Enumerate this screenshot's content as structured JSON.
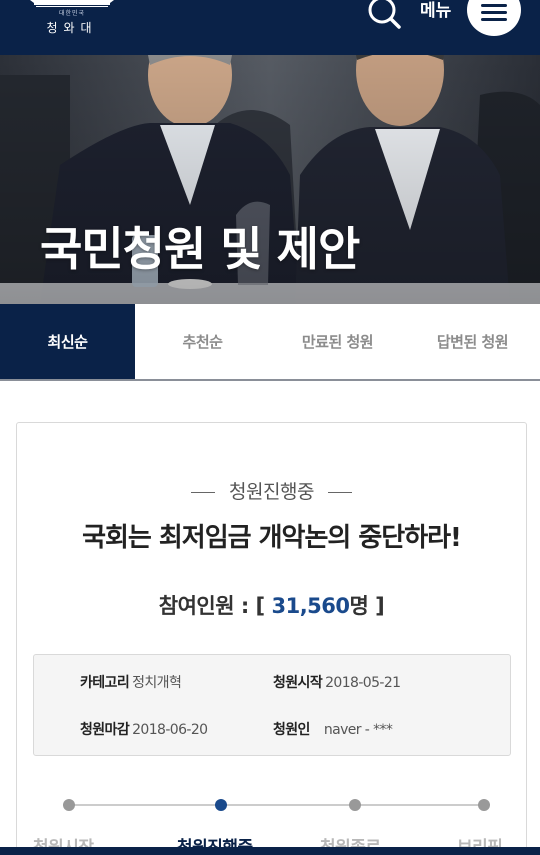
{
  "header": {
    "logo_sub": "대한민국",
    "logo_name": "청와대",
    "menu_label": "메뉴"
  },
  "icons": {
    "search": "search-icon",
    "menu": "hamburger-menu-icon"
  },
  "hero": {
    "title": "국민청원 및 제안"
  },
  "tabs": [
    {
      "label": "최신순",
      "active": true
    },
    {
      "label": "추천순",
      "active": false
    },
    {
      "label": "만료된 청원",
      "active": false
    },
    {
      "label": "답변된 청원",
      "active": false
    }
  ],
  "petition": {
    "status": "청원진행중",
    "title": "국회는 최저임금 개악논의 중단하라!",
    "participants_label": "참여인원 : [",
    "participants_count": "31,560",
    "participants_unit": "명 ]",
    "category_label": "카테고리",
    "category_value": "정치개혁",
    "start_label": "청원시작",
    "start_value": "2018-05-21",
    "end_label": "청원마감",
    "end_value": "2018-06-20",
    "author_label": "청원인",
    "author_value": "naver - ***"
  },
  "progress_steps": [
    {
      "label": "청원시작",
      "active": false
    },
    {
      "label": "청원진행중",
      "active": true
    },
    {
      "label": "청원종료",
      "active": false
    },
    {
      "label": "브리핑",
      "active": false
    }
  ],
  "colors": {
    "navy": "#0a2248",
    "accent": "#1a4a8c"
  }
}
